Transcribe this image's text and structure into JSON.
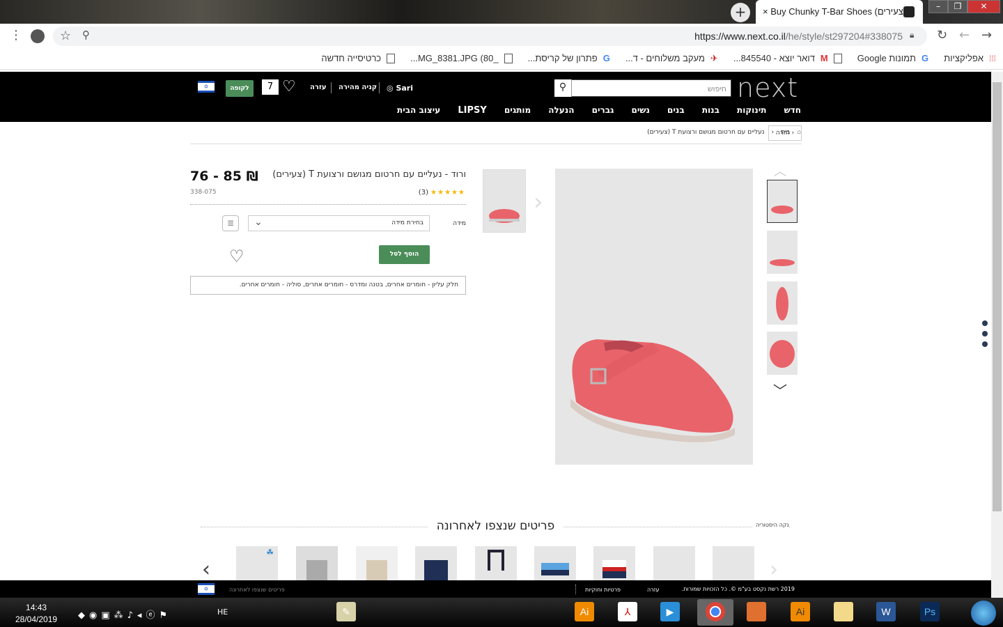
{
  "browser": {
    "tab_title": "Buy Chunky T-Bar Shoes (צעירים)",
    "url_host": "https://www.next.co.il",
    "url_path": "/he/style/st297204#338075",
    "new_tab": "+",
    "close_tab": "×"
  },
  "bookmarks": [
    {
      "label": "אפליקציות",
      "icon": "apps"
    },
    {
      "label": "תמונות Google",
      "icon": "google"
    },
    {
      "label": "דואר יוצא - 845540...",
      "icon": "gmail"
    },
    {
      "label": "מעקב משלוחים - ד...",
      "icon": "tracking"
    },
    {
      "label": "פתרון של קריסת...",
      "icon": "google"
    },
    {
      "label": "_MG_8381.JPG (80...",
      "icon": "page"
    },
    {
      "label": "כרטיסייה חדשה",
      "icon": "page"
    }
  ],
  "header": {
    "logo": "next",
    "search_placeholder": "חיפוש",
    "user": "Sari",
    "quick_buy": "קניה מהירה",
    "help": "עזרה",
    "cart_count": "7",
    "checkout": "לקופה"
  },
  "nav": [
    "חדש",
    "תינוקות",
    "בנות",
    "בנים",
    "נשים",
    "גברים",
    "הנעלה",
    "מותגים",
    "LIPSY",
    "עיצוב הבית"
  ],
  "breadcrumb": {
    "back": "חזרה",
    "home": "בית",
    "current": "נעליים עם חרטום מגושם ורצועת T (צעירים)"
  },
  "product": {
    "title": "ורוד - נעליים עם חרטום מגושם ורצועת T (צעירים)",
    "price": "76 - 85 ₪",
    "rating": 5,
    "stars": "★★★★★",
    "review_count": "(3)",
    "code": "338-075",
    "size_label": "מידה",
    "size_placeholder": "בחירת מידה",
    "add_to_bag": "הוסף לסל",
    "composition": "חלק עליון - חומרים אחרים, בטנה ומדרס - חומרים אחרים, סוליה - חומרים אחרים.",
    "color": "#e8646a"
  },
  "recent": {
    "title": "פריטים שנצפו לאחרונה",
    "clear": "נקה היסטוריה"
  },
  "footer": {
    "copyright": "2019 רשת נקסט בע\"מ ©. כל הזכויות שמורות.",
    "help": "עזרה",
    "privacy": "פרטיות וחוקיות",
    "recent": "פריטים שנצפו לאחרונה"
  },
  "taskbar": {
    "time": "14:43",
    "date": "28/04/2019",
    "lang": "HE"
  }
}
